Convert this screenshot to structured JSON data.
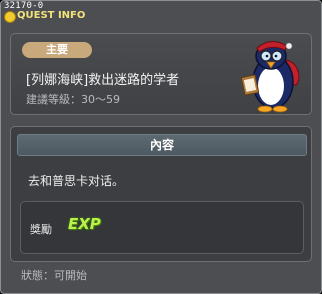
{
  "window": {
    "quest_id": "32170-0",
    "title": "QUEST INFO"
  },
  "quest": {
    "category": "主要",
    "name": "[列娜海峡]救出迷路的学者",
    "level_range": "建議等級：30～59",
    "npc_icon": "penguin-npc-icon"
  },
  "content": {
    "header": "內容",
    "task": "去和普思卡对话。",
    "reward_label": "獎勵",
    "reward_item": "EXP"
  },
  "status": {
    "text": "狀態：可開始"
  },
  "colors": {
    "window_bg": "#4c4e51",
    "badge": "#c8a97c",
    "exp_green": "#b8f24a",
    "title_yellow": "#f2e27a"
  }
}
